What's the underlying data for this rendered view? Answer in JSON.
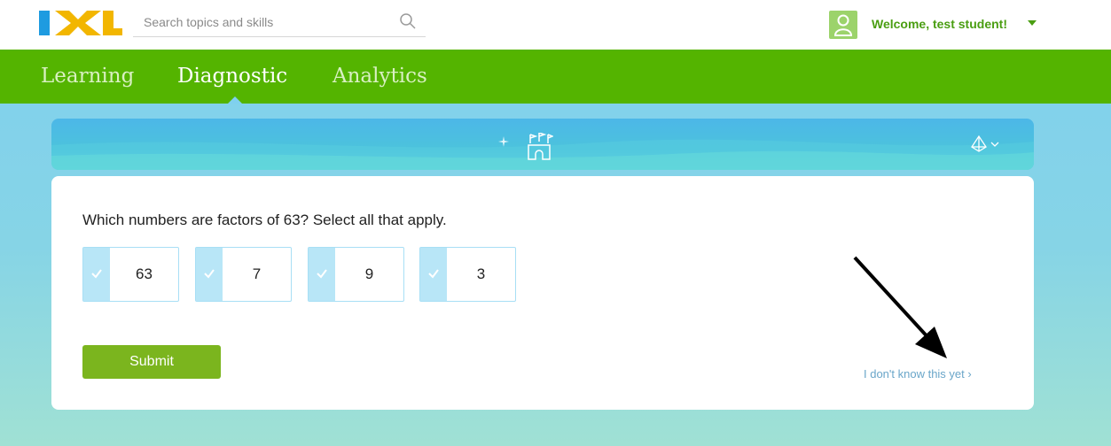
{
  "header": {
    "logo_alt": "IXL",
    "search_placeholder": "Search topics and skills",
    "welcome": "Welcome, test student!"
  },
  "nav": {
    "tabs": [
      {
        "label": "Learning",
        "active": false
      },
      {
        "label": "Diagnostic",
        "active": true
      },
      {
        "label": "Analytics",
        "active": false
      }
    ]
  },
  "banner": {
    "icon": "castle-icon",
    "menu_icon": "pyramid-icon"
  },
  "question": {
    "prompt": "Which numbers are factors of 63? Select all that apply.",
    "choices": [
      {
        "value": "63"
      },
      {
        "value": "7"
      },
      {
        "value": "9"
      },
      {
        "value": "3"
      }
    ],
    "submit_label": "Submit",
    "dont_know_label": "I don't know this yet ›"
  },
  "colors": {
    "nav_green": "#54b400",
    "submit_green": "#7bb51e",
    "link_blue": "#6aa6c9",
    "choice_check_bg": "#b8e6f7"
  }
}
